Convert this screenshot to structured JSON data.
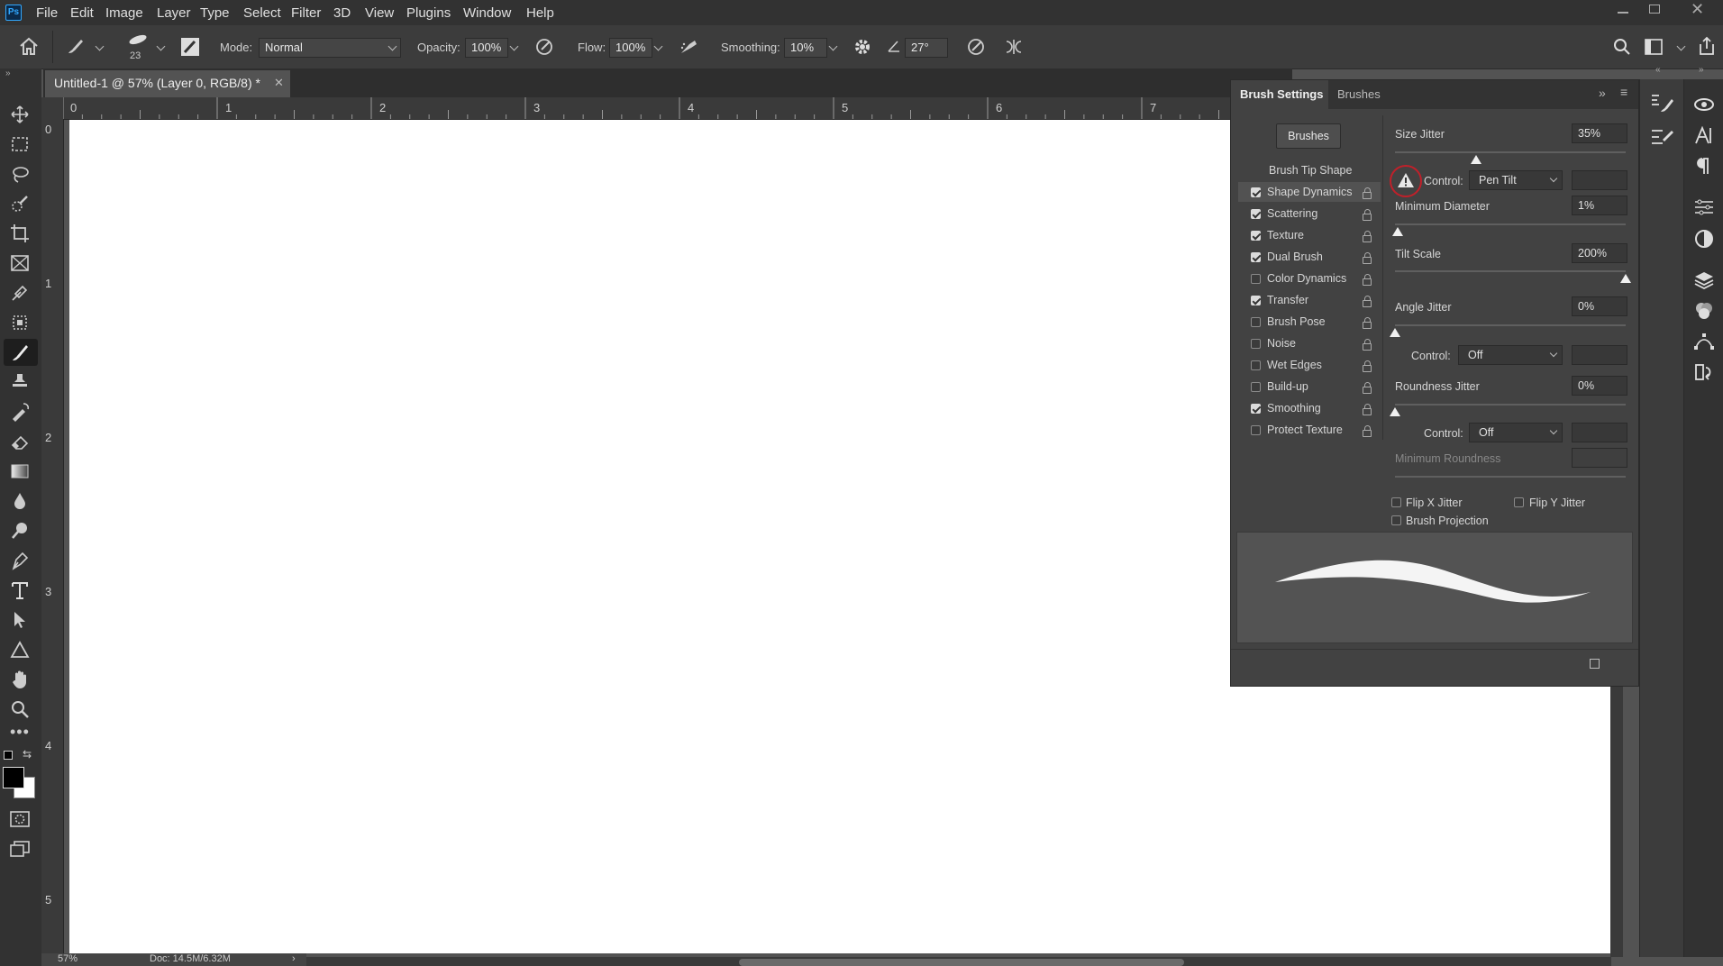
{
  "menubar": {
    "app_logo": "Ps",
    "items": [
      "File",
      "Edit",
      "Image",
      "Layer",
      "Type",
      "Select",
      "Filter",
      "3D",
      "View",
      "Plugins",
      "Window",
      "Help"
    ]
  },
  "options": {
    "brush_size": "23",
    "mode_label": "Mode:",
    "mode_value": "Normal",
    "opacity_label": "Opacity:",
    "opacity_value": "100%",
    "flow_label": "Flow:",
    "flow_value": "100%",
    "smoothing_label": "Smoothing:",
    "smoothing_value": "10%",
    "angle_value": "27°"
  },
  "document": {
    "tab_title": "Untitled-1 @ 57% (Layer 0, RGB/8) *",
    "zoom": "57%",
    "doc_size": "Doc: 14.5M/6.32M"
  },
  "rulers": {
    "h": [
      "0",
      "1",
      "2",
      "3",
      "4",
      "5",
      "6",
      "7"
    ],
    "v": [
      "0",
      "1",
      "2",
      "3",
      "4",
      "5"
    ]
  },
  "brush_panel": {
    "tabs": [
      "Brush Settings",
      "Brushes"
    ],
    "brushes_button": "Brushes",
    "tip_shape": "Brush Tip Shape",
    "options": [
      {
        "label": "Shape Dynamics",
        "checked": true
      },
      {
        "label": "Scattering",
        "checked": true
      },
      {
        "label": "Texture",
        "checked": true
      },
      {
        "label": "Dual Brush",
        "checked": true
      },
      {
        "label": "Color Dynamics",
        "checked": false
      },
      {
        "label": "Transfer",
        "checked": true
      },
      {
        "label": "Brush Pose",
        "checked": false
      },
      {
        "label": "Noise",
        "checked": false
      },
      {
        "label": "Wet Edges",
        "checked": false
      },
      {
        "label": "Build-up",
        "checked": false
      },
      {
        "label": "Smoothing",
        "checked": true
      },
      {
        "label": "Protect Texture",
        "checked": false
      }
    ],
    "size_jitter": {
      "label": "Size Jitter",
      "value": "35%",
      "level": 0.35
    },
    "control1": {
      "label": "Control:",
      "value": "Pen Tilt"
    },
    "min_diameter": {
      "label": "Minimum Diameter",
      "value": "1%",
      "level": 0.01
    },
    "tilt_scale": {
      "label": "Tilt Scale",
      "value": "200%",
      "level": 1.0
    },
    "angle_jitter": {
      "label": "Angle Jitter",
      "value": "0%",
      "level": 0.0
    },
    "control2": {
      "label": "Control:",
      "value": "Off"
    },
    "roundness_jitter": {
      "label": "Roundness Jitter",
      "value": "0%",
      "level": 0.0
    },
    "control3": {
      "label": "Control:",
      "value": "Off"
    },
    "min_roundness": {
      "label": "Minimum Roundness"
    },
    "flip_x": "Flip X Jitter",
    "flip_y": "Flip Y Jitter",
    "brush_projection": "Brush Projection"
  },
  "colors": {
    "foreground": "#000000",
    "background": "#ffffff",
    "warning_circle": "#c0202a"
  }
}
